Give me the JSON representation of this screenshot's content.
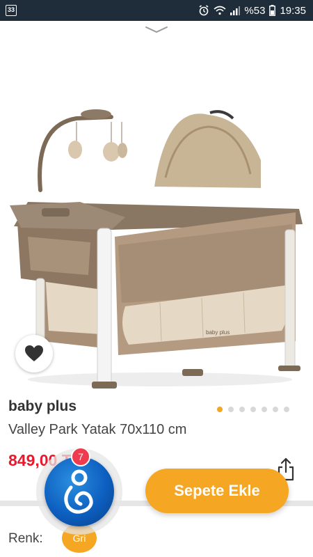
{
  "status_bar": {
    "app_badge": "33",
    "battery": "%53",
    "time": "19:35"
  },
  "product": {
    "brand": "baby plus",
    "name": "Valley Park Yatak 70x110 cm",
    "price": "849,00 TL",
    "image_count": 7,
    "active_image_index": 0
  },
  "assistant": {
    "badge_count": "7"
  },
  "actions": {
    "add_to_cart": "Sepete Ekle"
  },
  "color": {
    "label": "Renk:",
    "selected": "Gri"
  },
  "colors": {
    "accent": "#f5a623",
    "price": "#e8192c",
    "status_bar": "#1f2d3a",
    "assistant": "#0d5fbf"
  }
}
